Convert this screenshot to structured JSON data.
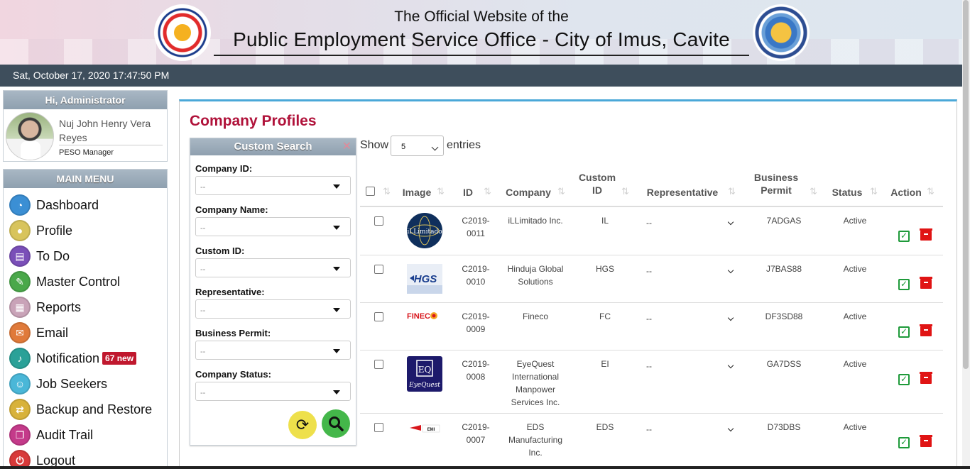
{
  "header": {
    "line1": "The Official Website of the",
    "line2": "Public Employment Service Office - City of Imus, Cavite"
  },
  "datetime": "Sat, October 17, 2020 17:47:50 PM",
  "user": {
    "greeting": "Hi, Administrator",
    "name": "Nuj John Henry Vera Reyes",
    "role": "PESO Manager"
  },
  "menu": {
    "title": "MAIN MENU",
    "items": [
      {
        "label": "Dashboard",
        "icon": "dashboard-icon",
        "color": "#3b8fd4"
      },
      {
        "label": "Profile",
        "icon": "user-icon",
        "color": "#d8c45c"
      },
      {
        "label": "To Do",
        "icon": "document-icon",
        "color": "#7a4fb8"
      },
      {
        "label": "Master Control",
        "icon": "wrench-icon",
        "color": "#4aa84a"
      },
      {
        "label": "Reports",
        "icon": "grid-icon",
        "color": "#c9a3b8"
      },
      {
        "label": "Email",
        "icon": "envelope-icon",
        "color": "#e07a3a"
      },
      {
        "label": "Notification",
        "icon": "bell-icon",
        "color": "#2aa198",
        "badge": "67 new"
      },
      {
        "label": "Job Seekers",
        "icon": "group-icon",
        "color": "#4ab7d8"
      },
      {
        "label": "Backup and Restore",
        "icon": "swap-icon",
        "color": "#d8b23a"
      },
      {
        "label": "Audit Trail",
        "icon": "copy-icon",
        "color": "#c43a8a"
      },
      {
        "label": "Logout",
        "icon": "power-icon",
        "color": "#d83a3a"
      }
    ]
  },
  "page": {
    "title": "Company Profiles"
  },
  "custom_search": {
    "title": "Custom Search",
    "fields": [
      {
        "label": "Company ID:",
        "value": "--"
      },
      {
        "label": "Company Name:",
        "value": "--"
      },
      {
        "label": "Custom ID:",
        "value": "--"
      },
      {
        "label": "Representative:",
        "value": "--"
      },
      {
        "label": "Business Permit:",
        "value": "--"
      },
      {
        "label": "Company Status:",
        "value": "--"
      }
    ]
  },
  "table_controls": {
    "show": "Show",
    "entries_value": "5",
    "entries": "entries"
  },
  "table": {
    "headers": {
      "image": "Image",
      "id": "ID",
      "company": "Company",
      "custom_id": "Custom ID",
      "representative": "Representative",
      "business_permit": "Business Permit",
      "status": "Status",
      "action": "Action"
    },
    "rows": [
      {
        "id": "C2019-0011",
        "company": "iLLimitado Inc.",
        "custom_id": "IL",
        "representative": "--",
        "permit": "7ADGAS",
        "status": "Active"
      },
      {
        "id": "C2019-0010",
        "company": "Hinduja Global Solutions",
        "custom_id": "HGS",
        "representative": "--",
        "permit": "J7BAS88",
        "status": "Active"
      },
      {
        "id": "C2019-0009",
        "company": "Fineco",
        "custom_id": "FC",
        "representative": "--",
        "permit": "DF3SD88",
        "status": "Active"
      },
      {
        "id": "C2019-0008",
        "company": "EyeQuest International Manpower Services Inc.",
        "custom_id": "EI",
        "representative": "--",
        "permit": "GA7DSS",
        "status": "Active"
      },
      {
        "id": "C2019-0007",
        "company": "EDS Manufacturing Inc.",
        "custom_id": "EDS",
        "representative": "--",
        "permit": "D73DBS",
        "status": "Active"
      }
    ]
  }
}
